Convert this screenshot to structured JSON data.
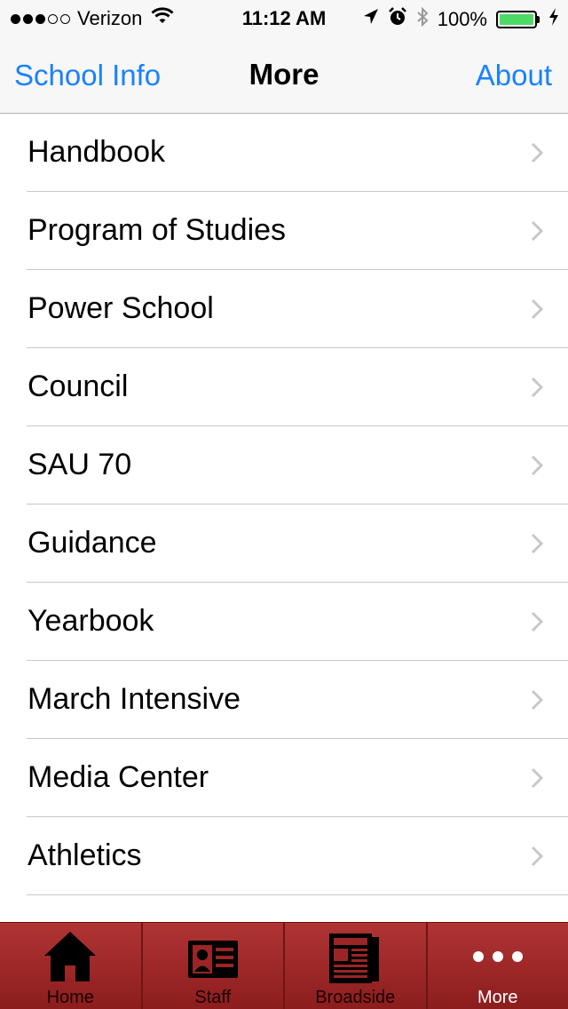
{
  "status_bar": {
    "carrier": "Verizon",
    "time": "11:12 AM",
    "battery": "100%",
    "signal_bars_filled": 3,
    "signal_bars_total": 5
  },
  "nav": {
    "left_label": "School Info",
    "title": "More",
    "right_label": "About"
  },
  "list": {
    "items": [
      {
        "label": "Handbook"
      },
      {
        "label": "Program of Studies"
      },
      {
        "label": "Power School"
      },
      {
        "label": "Council"
      },
      {
        "label": "SAU 70"
      },
      {
        "label": "Guidance"
      },
      {
        "label": "Yearbook"
      },
      {
        "label": "March Intensive"
      },
      {
        "label": "Media Center"
      },
      {
        "label": "Athletics"
      }
    ]
  },
  "tabs": [
    {
      "label": "Home",
      "icon": "home-icon"
    },
    {
      "label": "Staff",
      "icon": "id-card-icon"
    },
    {
      "label": "Broadside",
      "icon": "newspaper-icon"
    },
    {
      "label": "More",
      "icon": "more-dots-icon",
      "active": true
    }
  ],
  "colors": {
    "accent": "#1a82fb",
    "tab_bar": "#9b2525",
    "battery": "#4cd964"
  }
}
